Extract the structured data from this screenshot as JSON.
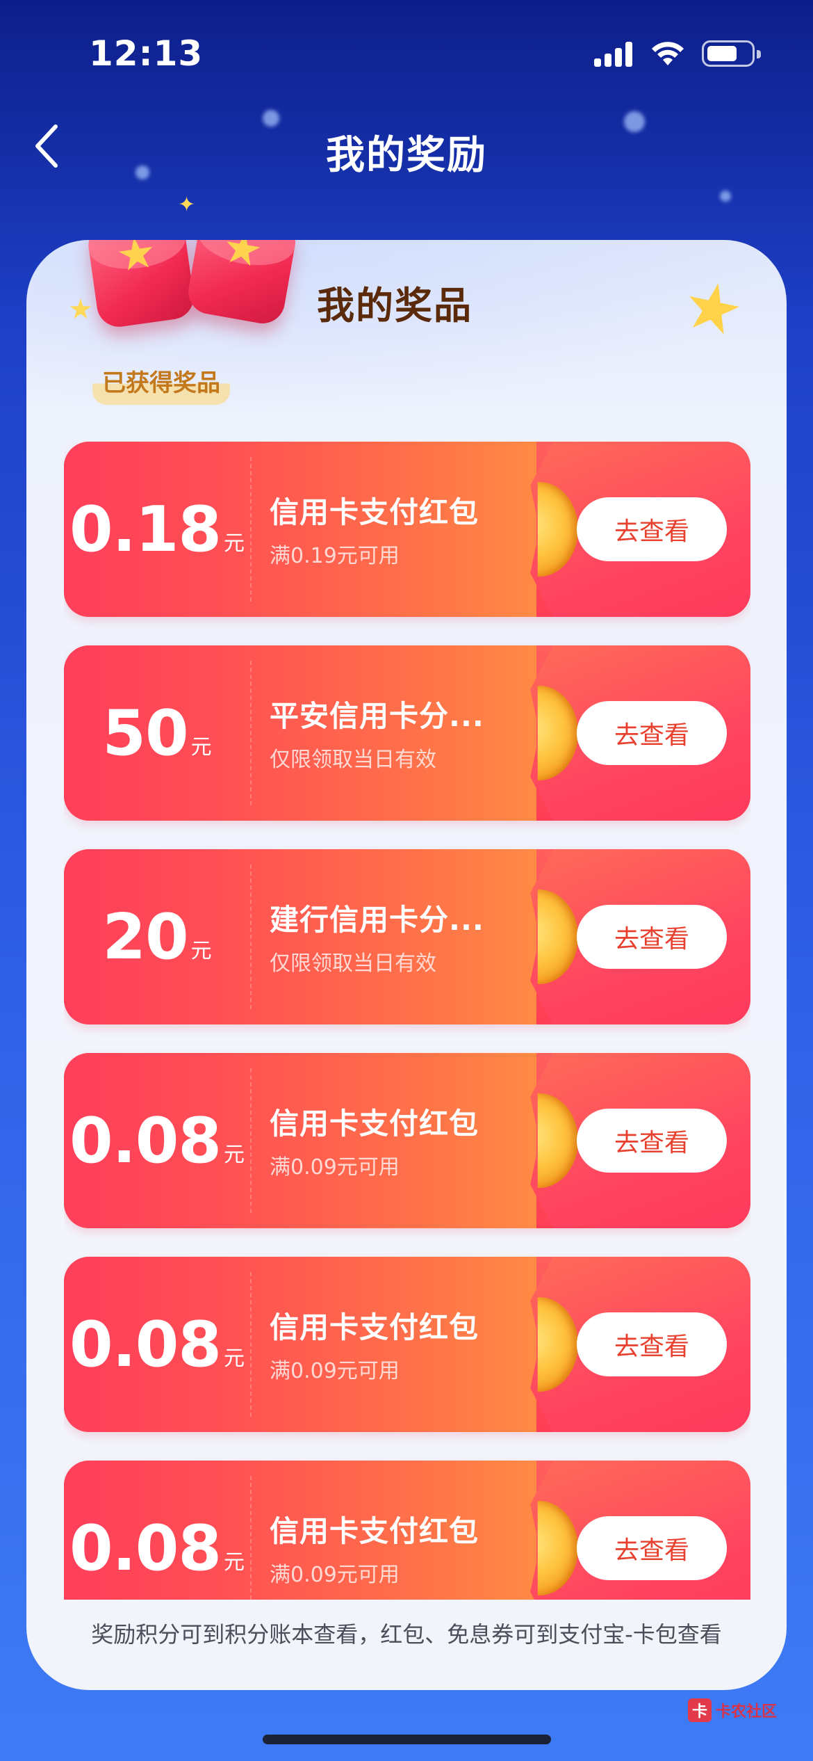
{
  "status_bar": {
    "time": "12:13"
  },
  "header": {
    "title": "我的奖励",
    "back_icon": "chevron-left-icon"
  },
  "section": {
    "title": "我的奖品",
    "subtitle": "已获得奖品"
  },
  "coupons": [
    {
      "amount": "0.18",
      "unit": "元",
      "name": "信用卡支付红包",
      "condition": "满0.19元可用",
      "button": "去查看"
    },
    {
      "amount": "50",
      "unit": "元",
      "name": "平安信用卡分...",
      "condition": "仅限领取当日有效",
      "button": "去查看"
    },
    {
      "amount": "20",
      "unit": "元",
      "name": "建行信用卡分...",
      "condition": "仅限领取当日有效",
      "button": "去查看"
    },
    {
      "amount": "0.08",
      "unit": "元",
      "name": "信用卡支付红包",
      "condition": "满0.09元可用",
      "button": "去查看"
    },
    {
      "amount": "0.08",
      "unit": "元",
      "name": "信用卡支付红包",
      "condition": "满0.09元可用",
      "button": "去查看"
    },
    {
      "amount": "0.08",
      "unit": "元",
      "name": "信用卡支付红包",
      "condition": "满0.09元可用",
      "button": "去查看"
    }
  ],
  "footer": {
    "note": "奖励积分可到积分账本查看，红包、免息券可到支付宝-卡包查看"
  },
  "watermark": {
    "text": "卡农社区"
  },
  "colors": {
    "accent": "#ff3e55",
    "button_text": "#e8402e",
    "title_brown": "#5a2a0a",
    "subtitle_gold": "#c4781c"
  }
}
